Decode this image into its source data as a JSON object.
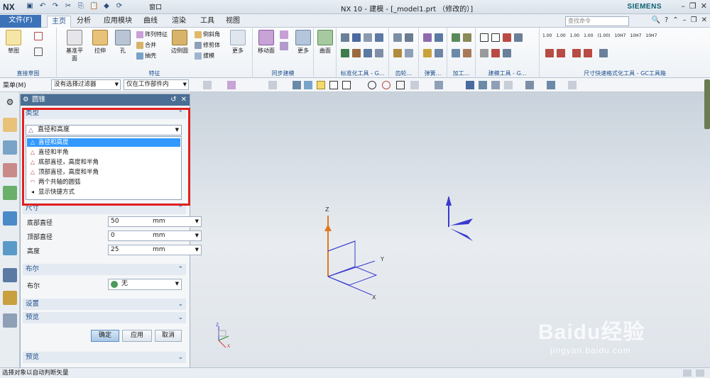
{
  "app": {
    "logo": "NX",
    "title": "NX 10 - 建模 - [_model1.prt （修改的）]",
    "brand": "SIEMENS",
    "window_menu": "窗口"
  },
  "tabs": [
    {
      "label": "文件(F)"
    },
    {
      "label": "主页"
    },
    {
      "label": "分析"
    },
    {
      "label": "应用模块"
    },
    {
      "label": "曲线"
    },
    {
      "label": "渲染"
    },
    {
      "label": "工具"
    },
    {
      "label": "视图"
    }
  ],
  "search": {
    "placeholder": "查找命令"
  },
  "ribbon": {
    "groups": {
      "sketch": "直接草图",
      "feature": "特征",
      "sync": "同步建模",
      "std": "标准化工具 - G...",
      "gear": "齿轮...",
      "spring": "弹簧...",
      "machining": "加工...",
      "build": "建模工具 - G...",
      "dim": "尺寸快速格式化工具 - GC工具箱"
    },
    "buttons": {
      "sketch": "草图",
      "datum": "基准平面",
      "extrude": "拉伸",
      "hole": "孔",
      "array": "阵列特征",
      "unite": "合并",
      "shell": "抽壳",
      "blend": "边倒圆",
      "chamfer": "倒斜角",
      "trim": "修剪体",
      "draft": "拔模",
      "more1": "更多",
      "move_face": "移动面",
      "more2": "更多",
      "surface": "曲面",
      "more3": "更多"
    },
    "dim_labels": [
      "1.00",
      "1.00",
      "1.00",
      "1.00",
      "(1.00)",
      "10H7",
      "10H7",
      "10H7"
    ]
  },
  "toolbar": {
    "menu": "菜单(M)",
    "filter": "没有选择过滤器",
    "scope": "仅在工作部件内"
  },
  "dialog": {
    "title": "圆锥",
    "type_section": "类型",
    "type_value": "直径和高度",
    "type_options": [
      "直径和高度",
      "直径和半角",
      "底部直径，高度和半角",
      "顶部直径，高度和半角",
      "两个共轴的圆弧",
      "显示快捷方式"
    ],
    "dims_section": "尺寸",
    "fields": [
      {
        "label": "底部直径",
        "value": "50",
        "unit": "mm"
      },
      {
        "label": "顶部直径",
        "value": "0",
        "unit": "mm"
      },
      {
        "label": "高度",
        "value": "25",
        "unit": "mm"
      }
    ],
    "boolean_section": "布尔",
    "boolean_label": "布尔",
    "boolean_value": "无",
    "settings_section": "设置",
    "preview_section": "预览",
    "ok": "确定",
    "apply": "应用",
    "cancel": "取消",
    "preview_bottom": "预览"
  },
  "viewport": {
    "axis_x": "X",
    "axis_y": "Y",
    "axis_z": "Z"
  },
  "status": {
    "text": "选择对象以自动判断矢量"
  },
  "watermark": {
    "brand": "Baidu经验",
    "url": "jingyan.baidu.com"
  }
}
